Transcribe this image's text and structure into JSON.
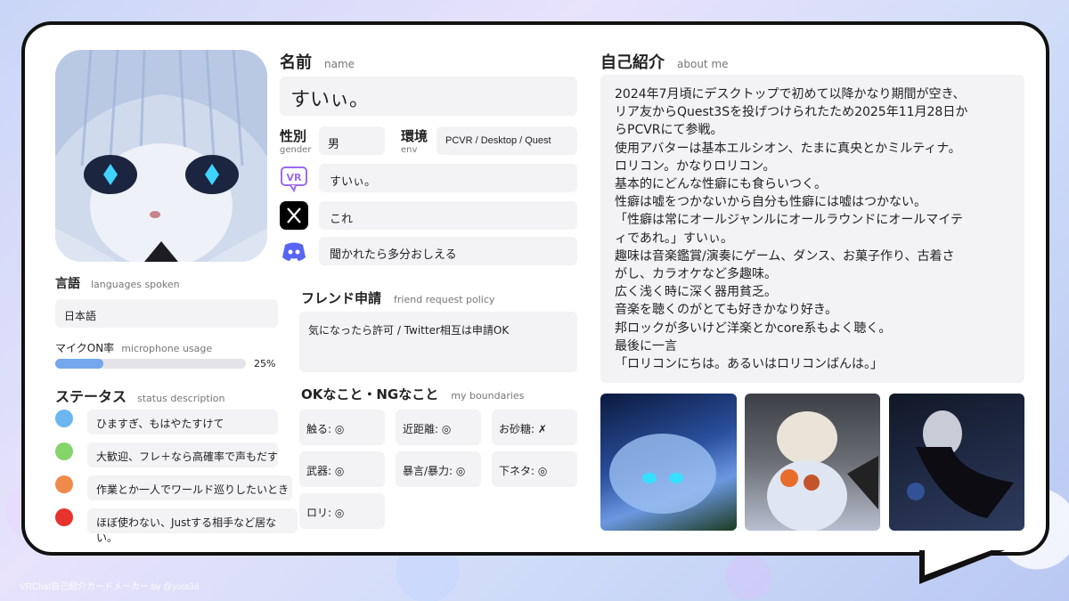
{
  "name": {
    "label": "名前",
    "label_en": "name",
    "value": "すいぃ。"
  },
  "gender": {
    "label": "性別",
    "label_en": "gender",
    "value": "男"
  },
  "env": {
    "label": "環境",
    "label_en": "env",
    "value": "PCVR / Desktop / Quest"
  },
  "accounts": {
    "vrchat": {
      "icon": "vrchat-icon",
      "value": "すいぃ。"
    },
    "x": {
      "icon": "x-icon",
      "value": "これ"
    },
    "discord": {
      "icon": "discord-icon",
      "value": "聞かれたら多分おしえる"
    }
  },
  "languages": {
    "label": "言語",
    "label_en": "languages spoken",
    "value": "日本語"
  },
  "mic": {
    "label": "マイクON率",
    "label_en": "microphone usage",
    "percent": 25,
    "percent_text": "25%"
  },
  "status": {
    "label": "ステータス",
    "label_en": "status description",
    "items": [
      {
        "color": "#6bb6ef",
        "text": "ひますぎ、もはやたすけて"
      },
      {
        "color": "#84d46a",
        "text": "大歓迎、フレ＋なら高確率で声もだす"
      },
      {
        "color": "#ef8a4b",
        "text": "作業とか一人でワールド巡りしたいとき"
      },
      {
        "color": "#e8322d",
        "text": "ほぼ使わない、Justする相手など居ない。"
      }
    ]
  },
  "friend_policy": {
    "label": "フレンド申請",
    "label_en": "friend request policy",
    "value": "気になったら許可 / Twitter相互は申請OK"
  },
  "boundaries": {
    "label": "OKなこと・NGなこと",
    "label_en": "my boundaries",
    "items": [
      "触る: ◎",
      "近距離: ◎",
      "お砂糖: ✗",
      "武器: ◎",
      "暴言/暴力: ◎",
      "下ネタ: ◎",
      "ロリ: ◎"
    ]
  },
  "about": {
    "label": "自己紹介",
    "label_en": "about me",
    "lines": [
      "2024年7月頃にデスクトップで初めて以降かなり期間が空き、",
      "リア友からQuest3Sを投げつけられたため2025年11月28日か",
      "らPCVRにて参戦。",
      "使用アバターは基本エルシオン、たまに真央とかミルティナ。",
      "ロリコン。かなりロリコン。",
      "基本的にどんな性癖にも食らいつく。",
      "性癖は嘘をつかないから自分も性癖には嘘はつかない。",
      "「性癖は常にオールジャンルにオールラウンドにオールマイテ",
      "ィであれ。」すいぃ。",
      "趣味は音楽鑑賞/演奏にゲーム、ダンス、お菓子作り、古着さ",
      "がし、カラオケなど多趣味。",
      "広く浅く時に深く器用貧乏。",
      "音楽を聴くのがとても好きかなり好き。",
      "邦ロックが多いけど洋楽とかcore系もよく聴く。",
      "最後に一言",
      "「ロリコンにちは。あるいはロリコンばんは。」"
    ]
  },
  "footer": "VRChat自己紹介カードメーカー by @yota3d"
}
